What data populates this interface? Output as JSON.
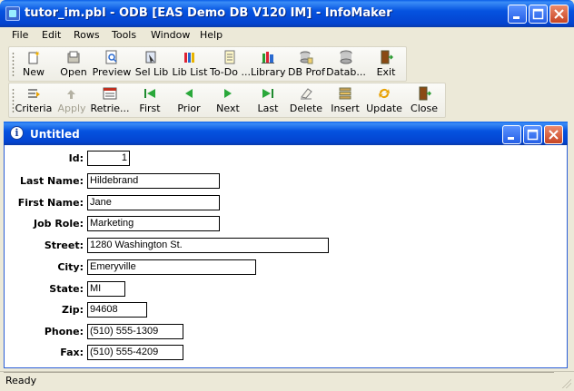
{
  "app": {
    "title": "tutor_im.pbl - ODB [EAS Demo DB V120 IM]  - InfoMaker"
  },
  "menu": [
    "File",
    "Edit",
    "Rows",
    "Tools",
    "Window",
    "Help"
  ],
  "toolbar1": [
    {
      "label": "New",
      "icon": "new-icon"
    },
    {
      "label": "Open",
      "icon": "open-icon"
    },
    {
      "label": "Preview",
      "icon": "preview-icon"
    },
    {
      "label": "Sel Lib",
      "icon": "select-library-icon"
    },
    {
      "label": "Lib List",
      "icon": "library-list-icon"
    },
    {
      "label": "To-Do ...",
      "icon": "todo-icon"
    },
    {
      "label": "Library",
      "icon": "library-icon"
    },
    {
      "label": "DB Prof",
      "icon": "db-profile-icon"
    },
    {
      "label": "Datab...",
      "icon": "database-icon"
    },
    {
      "label": "Exit",
      "icon": "exit-icon"
    }
  ],
  "toolbar2": [
    {
      "label": "Criteria",
      "icon": "criteria-icon"
    },
    {
      "label": "Apply",
      "icon": "apply-icon",
      "disabled": true
    },
    {
      "label": "Retrie...",
      "icon": "retrieve-icon"
    },
    {
      "label": "First",
      "icon": "first-icon"
    },
    {
      "label": "Prior",
      "icon": "prior-icon"
    },
    {
      "label": "Next",
      "icon": "next-icon"
    },
    {
      "label": "Last",
      "icon": "last-icon"
    },
    {
      "label": "Delete",
      "icon": "delete-icon"
    },
    {
      "label": "Insert",
      "icon": "insert-icon"
    },
    {
      "label": "Update",
      "icon": "update-icon"
    },
    {
      "label": "Close",
      "icon": "close-door-icon"
    }
  ],
  "child_window": {
    "title": "Untitled"
  },
  "form": {
    "id": {
      "label": "Id:",
      "value": "1"
    },
    "last_name": {
      "label": "Last Name:",
      "value": "Hildebrand"
    },
    "first_name": {
      "label": "First Name:",
      "value": "Jane"
    },
    "job_role": {
      "label": "Job Role:",
      "value": "Marketing"
    },
    "street": {
      "label": "Street:",
      "value": "1280 Washington St."
    },
    "city": {
      "label": "City:",
      "value": "Emeryville"
    },
    "state": {
      "label": "State:",
      "value": "MI"
    },
    "zip": {
      "label": "Zip:",
      "value": "94608"
    },
    "phone": {
      "label": "Phone:",
      "value": "(510) 555-1309"
    },
    "fax": {
      "label": "Fax:",
      "value": "(510) 555-4209"
    }
  },
  "status": {
    "text": "Ready"
  },
  "colors": {
    "titlebar": "#0553e0",
    "window_bg": "#ece9d8",
    "close_button": "#c74422"
  }
}
